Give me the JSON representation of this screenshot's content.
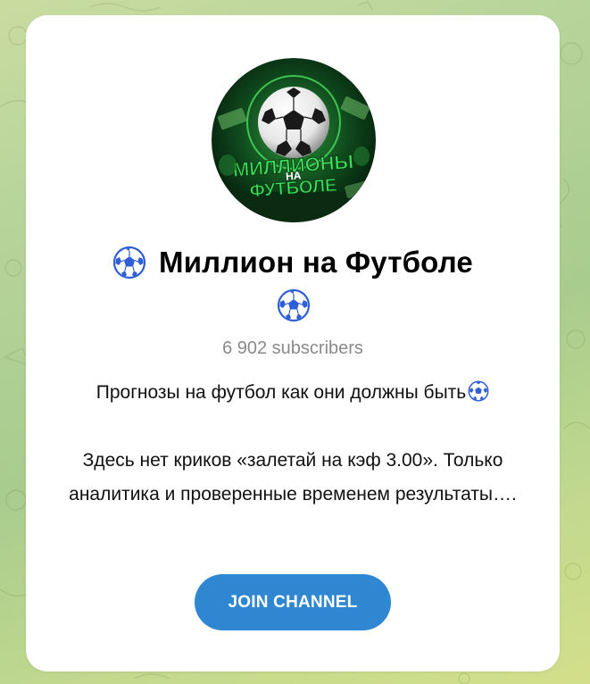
{
  "channel": {
    "avatar_caption_line1": "МИЛЛИОНЫ",
    "avatar_caption_mid": "НА",
    "avatar_caption_line2": "ФУТБОЛЕ",
    "title": "Миллион на Футболе",
    "subscribers": "6 902 subscribers",
    "description_line1": "Прогнозы на футбол как они должны быть",
    "description_line2": "Здесь нет криков «залетай на кэф 3.00». Только аналитика и проверенные временем результаты…."
  },
  "actions": {
    "join_label": "JOIN CHANNEL"
  },
  "colors": {
    "accent": "#2f86d1",
    "avatar_green": "#1fa13a",
    "ball_blue": "#2f5fd6"
  },
  "icons": {
    "title_emoji": "soccer-ball-icon",
    "avatar": "channel-avatar"
  }
}
